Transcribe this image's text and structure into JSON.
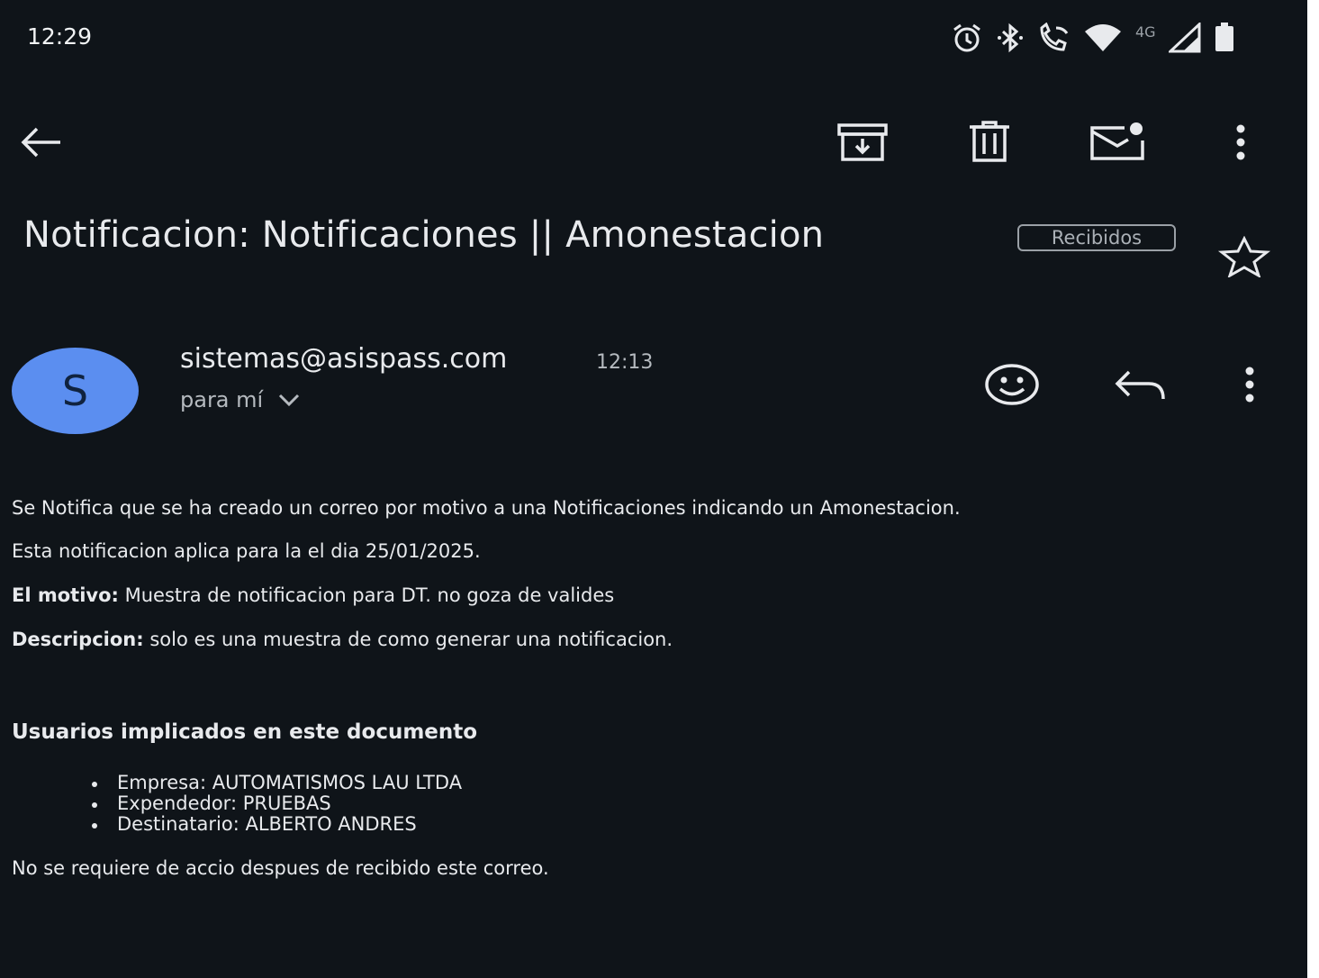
{
  "status_bar": {
    "time": "12:29",
    "network_label": "4G",
    "icons": [
      "alarm-icon",
      "bluetooth-icon",
      "wifi-call-icon",
      "wifi-icon",
      "signal-icon",
      "battery-icon"
    ]
  },
  "toolbar": {
    "icons": [
      "back-arrow-icon",
      "archive-icon",
      "delete-icon",
      "mark-unread-icon",
      "more-vert-icon"
    ]
  },
  "email": {
    "subject": "Notificacion: Notificaciones || Amonestacion",
    "label": "Recibidos",
    "avatar_letter": "S",
    "sender": "sistemas@asispass.com",
    "time": "12:13",
    "recipient": "para mí",
    "body": {
      "intro": "Se Notifica que se ha creado un correo por motivo a una Notificaciones indicando un Amonestacion.",
      "date_line": "Esta notificacion aplica para la el dia 25/01/2025.",
      "motivo_label": "El motivo:",
      "motivo_value": " Muestra de notificacion para DT. no goza de valides",
      "descripcion_label": "Descripcion:",
      "descripcion_value": " solo es una muestra de como generar una notificacion.",
      "users_heading": "Usuarios implicados en este documento",
      "users": [
        "Empresa: AUTOMATISMOS LAU LTDA",
        "Expendedor: PRUEBAS",
        "Destinatario: ALBERTO ANDRES"
      ],
      "footer": "No se requiere de accio despues de recibido este correo."
    }
  },
  "colors": {
    "background": "#0f1419",
    "avatar": "#5b8ef0",
    "text": "#e8eaed",
    "muted": "#b5babf"
  }
}
